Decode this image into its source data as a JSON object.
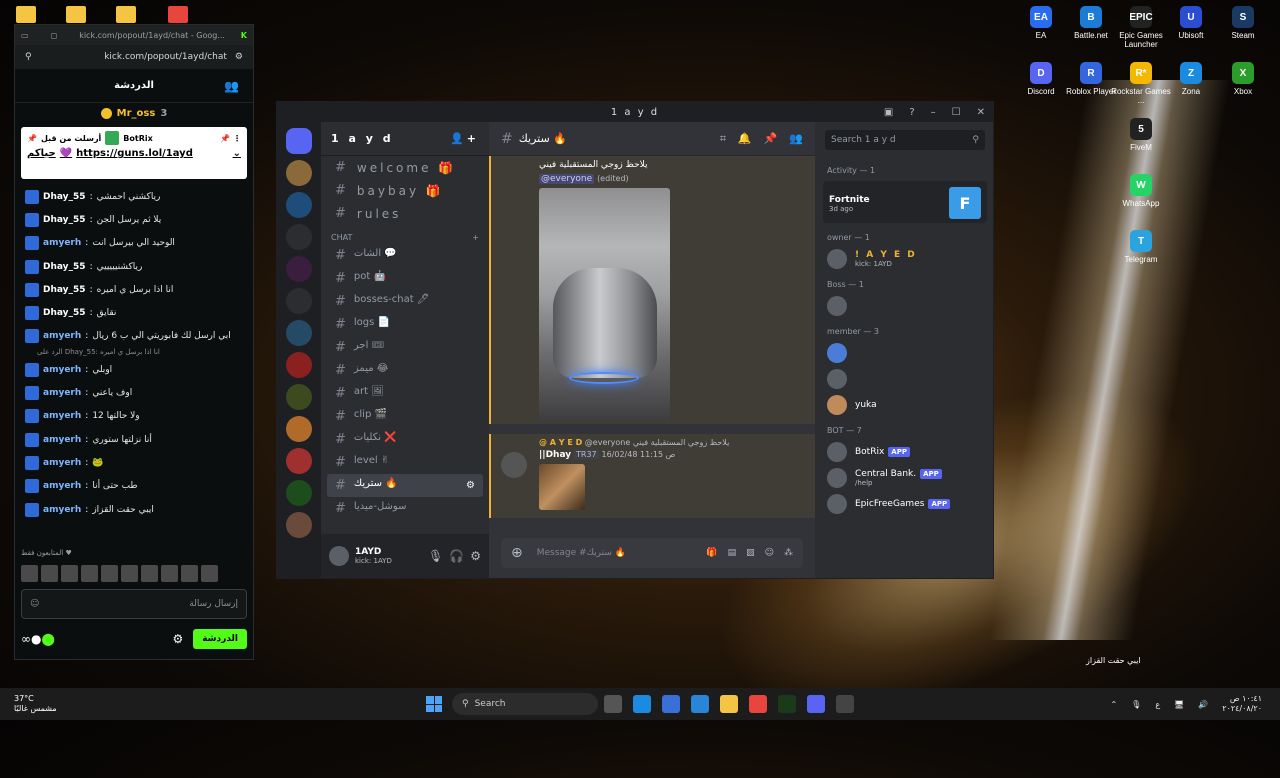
{
  "desktop": {
    "icons": [
      {
        "label": "EA",
        "color": "#2a6cf0",
        "glyph": "EA"
      },
      {
        "label": "Battle.net",
        "color": "#1d7bd8",
        "glyph": "B"
      },
      {
        "label": "Epic Games Launcher",
        "color": "#222",
        "glyph": "EPIC"
      },
      {
        "label": "Ubisoft",
        "color": "#2b4dd1",
        "glyph": "U"
      },
      {
        "label": "Steam",
        "color": "#1b3a63",
        "glyph": "S"
      },
      {
        "label": "Discord",
        "color": "#5865f2",
        "glyph": "D"
      },
      {
        "label": "Roblox Player",
        "color": "#3466e0",
        "glyph": "R"
      },
      {
        "label": "Rockstar Games ...",
        "color": "#f5b800",
        "glyph": "R*"
      },
      {
        "label": "Zona",
        "color": "#1a8be0",
        "glyph": "Z"
      },
      {
        "label": "Xbox",
        "color": "#2a9d2a",
        "glyph": "X"
      },
      {
        "label": "FiveM",
        "color": "#222",
        "glyph": "5"
      },
      {
        "label": "WhatsApp",
        "color": "#25d366",
        "glyph": "W"
      },
      {
        "label": "Telegram",
        "color": "#2aa3df",
        "glyph": "T"
      }
    ],
    "notification": "ايبي حقت القزاز"
  },
  "kick": {
    "title": "kick.com/popout/1ayd/chat - Goog...",
    "url": "kick.com/popout/1ayd/chat",
    "header": "الدردشة",
    "gift_user": "Mr_oss",
    "gift_count": "3",
    "pinned_by": "أرسلت من قبل",
    "pinned_user": "BotRix",
    "pinned_prefix": "حياكم",
    "pinned_link": "https://guns.lol/1ayd",
    "messages": [
      {
        "name": "Dhay_55",
        "text": "رياكشني احمشي",
        "color": "#ffffff"
      },
      {
        "name": "Dhay_55",
        "text": "يلا ثم يرسل الجن",
        "color": "#ffffff"
      },
      {
        "name": "amyerh",
        "text": "الوحيد الي بيرسل انت",
        "color": "#7fb4ff"
      },
      {
        "name": "Dhay_55",
        "text": "رياكشنيييييي",
        "color": "#ffffff"
      },
      {
        "name": "Dhay_55",
        "text": "انا اذا برسل ي اميره",
        "color": "#ffffff"
      },
      {
        "name": "Dhay_55",
        "text": "نقايق",
        "color": "#ffffff"
      },
      {
        "name": "amyerh",
        "text": "ابي ارسل لك فابوريتي الي ب 6 ريال",
        "color": "#7fb4ff"
      },
      {
        "name": "amyerh",
        "text": "اوبلي",
        "color": "#7fb4ff"
      },
      {
        "name": "amyerh",
        "text": "اوف ياعني",
        "color": "#7fb4ff"
      },
      {
        "name": "amyerh",
        "text": "ولا حالتها 12",
        "color": "#7fb4ff"
      },
      {
        "name": "amyerh",
        "text": "أنا نزلتها ستوري",
        "color": "#7fb4ff"
      },
      {
        "name": "amyerh",
        "text": "🐸",
        "color": "#7fb4ff"
      },
      {
        "name": "amyerh",
        "text": "طب حتى أنا",
        "color": "#7fb4ff"
      },
      {
        "name": "amyerh",
        "text": "ايبي حقت القزاز",
        "color": "#7fb4ff"
      }
    ],
    "reply_note": "الرد على Dhay_55: انا اذا برسل ي اميره",
    "supporters_label": "المتابعون فقط ♥",
    "input_placeholder": "إرسال رسالة",
    "chat_button": "الدردشة"
  },
  "discord": {
    "title": "1 a y d",
    "guild": "1 a y d",
    "channels_top": [
      "welcome 🎁",
      "baybay 🎁",
      "rules"
    ],
    "category": "CHAT",
    "channels": [
      "الشات 💬",
      "pot 🤖",
      "bosses-chat 🖊",
      "logs 📄",
      "اجر 🎟",
      "ميمز 😂",
      "art 🖼",
      "clip 🎬",
      "نكليات ❌",
      "level ✌",
      "ستريك 🔥",
      "سوشل-ميديا"
    ],
    "user_name": "1AYD",
    "user_sub": "kick: 1AYD",
    "channel_name": "ستريك 🔥",
    "message1_text": "يلاحظ زوجي المستقبلية فيني",
    "everyone": "@everyone",
    "edited": "(edited)",
    "message2_author": "@ A Y E D",
    "message2_reply": "@everyone يلاحظ زوجي المستقبلية فيني",
    "message2_user": "||Dhay",
    "message2_tag": "TR37",
    "message2_time": "16/02/48 11:15 ص",
    "composer_placeholder": "Message #ستريك 🔥",
    "search_placeholder": "Search 1 a y d",
    "activity_group": "Activity — 1",
    "activity_game": "Fortnite",
    "activity_time": "3d ago",
    "owner_group": "owner — 1",
    "owner_name": "! A Y E D",
    "owner_sub": "kick: 1AYD",
    "boss_group": "Boss — 1",
    "member_group": "member — 3",
    "member_yuka": "yuka",
    "bot_group": "BOT — 7",
    "bots": [
      {
        "name": "BotRix",
        "sub": ""
      },
      {
        "name": "Central Bank.",
        "sub": "/help"
      },
      {
        "name": "EpicFreeGames",
        "sub": ""
      }
    ],
    "app_tag": "APP"
  },
  "taskbar": {
    "temp": "37°C",
    "weather": "مشمس غالبًا",
    "search": "Search",
    "time": "١٠:٤١ ص",
    "date": "٢٠٢٤/٠٨/٢٠",
    "lang": "ع"
  }
}
